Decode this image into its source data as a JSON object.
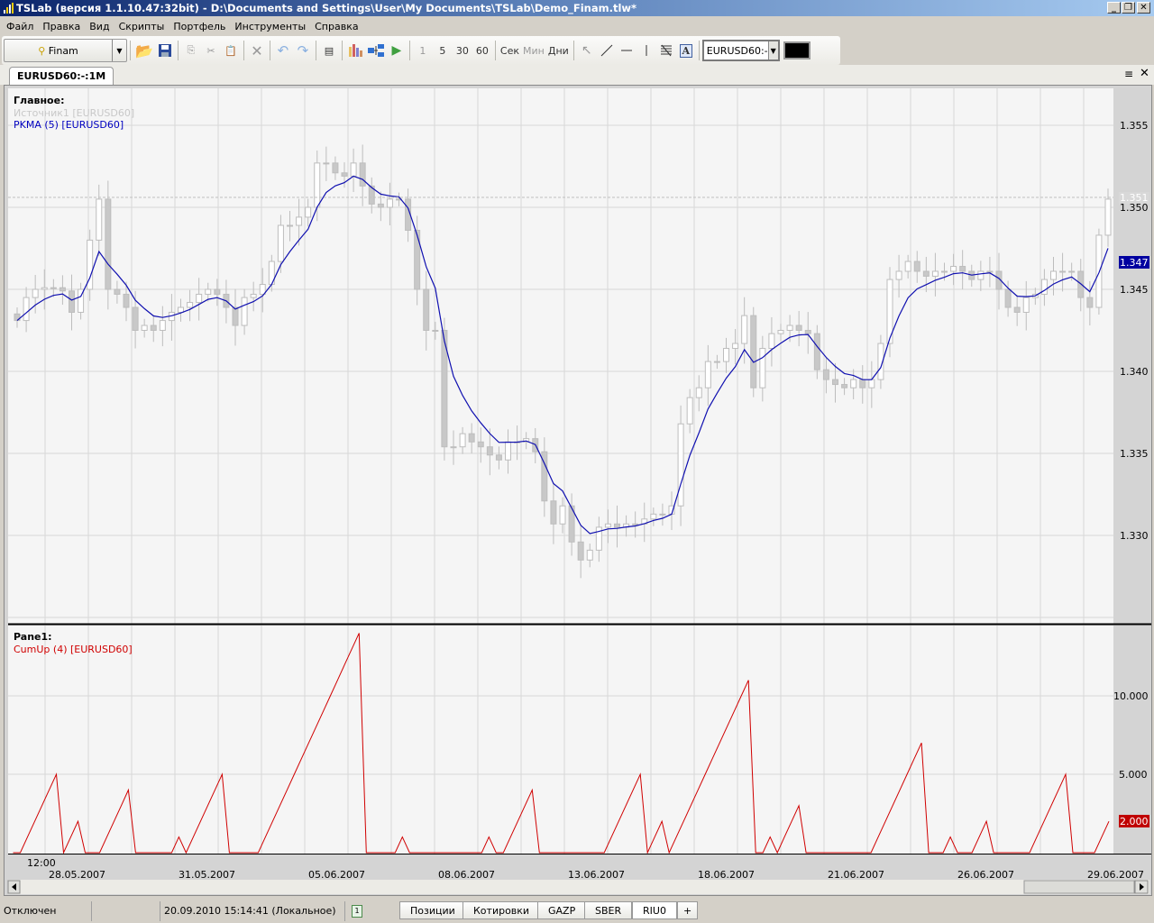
{
  "window": {
    "title": "TSLab (версия 1.1.10.47:32bit) - D:\\Documents and Settings\\User\\My Documents\\TSLab\\Demo_Finam.tlw*",
    "minimize": "_",
    "restore": "❐",
    "close": "✕"
  },
  "menu": [
    "Файл",
    "Правка",
    "Вид",
    "Скрипты",
    "Портфель",
    "Инструменты",
    "Справка"
  ],
  "toolbar": {
    "broker": "Finam",
    "intervals": [
      "1",
      "5",
      "30",
      "60"
    ],
    "units": [
      "Сек",
      "Мин",
      "Дни"
    ],
    "symbol": "EURUSD60:-",
    "color": "#000000"
  },
  "tab": {
    "label": "EURUSD60:-:1M"
  },
  "main_pane": {
    "title": "Главное:",
    "source": "Источник1 [EURUSD60]",
    "indicator": "PKMA (5) [EURUSD60]",
    "price_ticks": [
      "1.355",
      "1.350",
      "1.345",
      "1.340",
      "1.335",
      "1.330"
    ],
    "last_source": "1.351",
    "last_indicator": "1.347"
  },
  "lower_pane": {
    "title": "Pane1:",
    "indicator": "CumUp (4) [EURUSD60]",
    "ticks": [
      "10.000",
      "5.000"
    ],
    "last_value": "2.000"
  },
  "time_axis": {
    "time": "12:00",
    "dates": [
      "28.05.2007",
      "31.05.2007",
      "05.06.2007",
      "08.06.2007",
      "13.06.2007",
      "18.06.2007",
      "21.06.2007",
      "26.06.2007",
      "29.06.2007"
    ]
  },
  "status": {
    "connection": "Отключен",
    "datetime": "20.09.2010 15:14:41 (Локальное)",
    "badge": "1",
    "tabs": [
      "Позиции",
      "Котировки",
      "GAZP",
      "SBER",
      "RIU0"
    ],
    "add": "+"
  },
  "chart_data": [
    {
      "type": "candlestick",
      "title": "Главное",
      "series": [
        {
          "name": "Источник1 [EURUSD60]",
          "color": "#c8c8c8",
          "close": [
            1.3431,
            1.3445,
            1.345,
            1.3451,
            1.3451,
            1.3449,
            1.3436,
            1.345,
            1.348,
            1.3505,
            1.345,
            1.3447,
            1.3439,
            1.3425,
            1.3428,
            1.3425,
            1.3431,
            1.3436,
            1.3439,
            1.3442,
            1.3447,
            1.345,
            1.3447,
            1.3439,
            1.3428,
            1.3445,
            1.3447,
            1.3453,
            1.3467,
            1.3489,
            1.3489,
            1.3494,
            1.35,
            1.3527,
            1.3527,
            1.3521,
            1.3519,
            1.3527,
            1.3513,
            1.3502,
            1.35,
            1.3505,
            1.3505,
            1.3486,
            1.345,
            1.3425,
            1.3425,
            1.3354,
            1.3354,
            1.3362,
            1.3357,
            1.3354,
            1.3349,
            1.3346,
            1.3357,
            1.3357,
            1.3359,
            1.3351,
            1.3321,
            1.3307,
            1.3318,
            1.3296,
            1.3285,
            1.3291,
            1.3305,
            1.3307,
            1.3305,
            1.3307,
            1.3307,
            1.331,
            1.3313,
            1.3313,
            1.3318,
            1.3368,
            1.3384,
            1.339,
            1.3406,
            1.3406,
            1.3414,
            1.3417,
            1.3434,
            1.339,
            1.3414,
            1.3423,
            1.3425,
            1.3428,
            1.3425,
            1.3423,
            1.3401,
            1.3395,
            1.3392,
            1.339,
            1.3395,
            1.339,
            1.3395,
            1.3417,
            1.3456,
            1.3461,
            1.3467,
            1.3461,
            1.3458,
            1.3461,
            1.3461,
            1.3464,
            1.3461,
            1.3456,
            1.3461,
            1.3461,
            1.345,
            1.3439,
            1.3436,
            1.3445,
            1.3447,
            1.3456,
            1.3461,
            1.3461,
            1.3461,
            1.3445,
            1.3439,
            1.3483,
            1.3505
          ]
        },
        {
          "name": "PKMA (5) [EURUSD60]",
          "color": "#0000c0",
          "period": 5
        }
      ],
      "ylim": [
        1.3245,
        1.3575
      ]
    },
    {
      "type": "line",
      "title": "Pane1",
      "series": [
        {
          "name": "CumUp (4) [EURUSD60]",
          "color": "#d00000",
          "values": [
            0,
            0,
            1,
            2,
            3,
            4,
            5,
            0,
            1,
            2,
            0,
            0,
            0,
            1,
            2,
            3,
            4,
            0,
            0,
            0,
            0,
            0,
            0,
            1,
            0,
            1,
            2,
            3,
            4,
            5,
            0,
            0,
            0,
            0,
            0,
            1,
            2,
            3,
            4,
            5,
            6,
            7,
            8,
            9,
            10,
            11,
            12,
            13,
            14,
            0,
            0,
            0,
            0,
            0,
            1,
            0,
            0,
            0,
            0,
            0,
            0,
            0,
            0,
            0,
            0,
            0,
            1,
            0,
            0,
            1,
            2,
            3,
            4,
            0,
            0,
            0,
            0,
            0,
            0,
            0,
            0,
            0,
            0,
            1,
            2,
            3,
            4,
            5,
            0,
            1,
            2,
            0,
            1,
            2,
            3,
            4,
            5,
            6,
            7,
            8,
            9,
            10,
            11,
            0,
            0,
            1,
            0,
            1,
            2,
            3,
            0,
            0,
            0,
            0,
            0,
            0,
            0,
            0,
            0,
            0,
            1,
            2,
            3,
            4,
            5,
            6,
            7,
            0,
            0,
            0,
            1,
            0,
            0,
            0,
            1,
            2,
            0,
            0,
            0,
            0,
            0,
            0,
            1,
            2,
            3,
            4,
            5,
            0,
            0,
            0,
            0,
            1,
            2
          ]
        }
      ],
      "ylim": [
        0,
        14.5
      ]
    }
  ]
}
